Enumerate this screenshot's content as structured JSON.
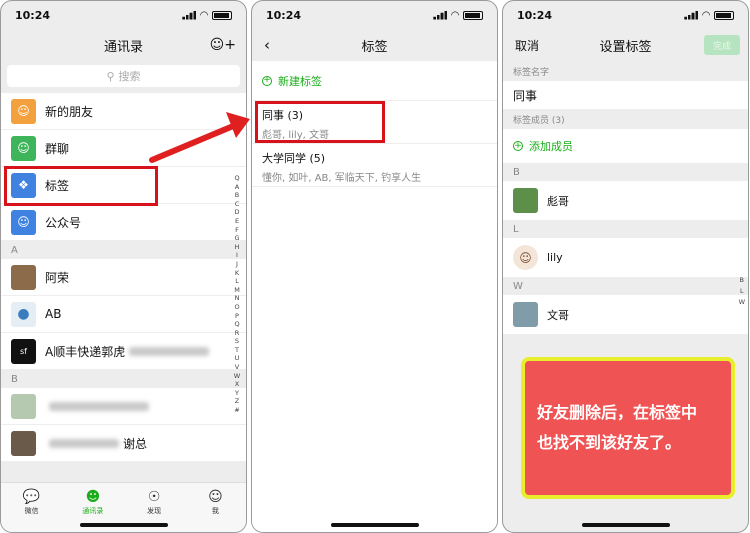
{
  "status": {
    "time": "10:24"
  },
  "contacts": {
    "title": "通讯录",
    "search_placeholder": "搜索",
    "entries": [
      {
        "label": "新的朋友",
        "color": "#f3a13f",
        "icon": "person-add-icon"
      },
      {
        "label": "群聊",
        "color": "#3eb55b",
        "icon": "group-icon"
      },
      {
        "label": "标签",
        "color": "#3f82e0",
        "icon": "tag-icon"
      },
      {
        "label": "公众号",
        "color": "#3f82e0",
        "icon": "person-icon"
      }
    ],
    "section_a": "A",
    "section_b": "B",
    "people_a": [
      {
        "name": "阿荣"
      },
      {
        "name": "AB"
      },
      {
        "name": "A顺丰快递郭虎"
      }
    ],
    "people_b": [
      {
        "name": ""
      },
      {
        "name": "谢总"
      }
    ],
    "alphabet": [
      "Q",
      "A",
      "B",
      "C",
      "D",
      "E",
      "F",
      "G",
      "H",
      "I",
      "J",
      "K",
      "L",
      "M",
      "N",
      "O",
      "P",
      "Q",
      "R",
      "S",
      "T",
      "U",
      "V",
      "W",
      "X",
      "Y",
      "Z",
      "#"
    ]
  },
  "tabbar": {
    "items": [
      {
        "label": "微信",
        "icon": "chat-bubble-icon"
      },
      {
        "label": "通讯录",
        "icon": "contacts-icon"
      },
      {
        "label": "发现",
        "icon": "compass-icon"
      },
      {
        "label": "我",
        "icon": "me-icon"
      }
    ]
  },
  "tags": {
    "title": "标签",
    "new_tag": "新建标签",
    "items": [
      {
        "name": "同事 (3)",
        "members": "彪哥, lily, 文哥"
      },
      {
        "name": "大学同学 (5)",
        "members": "懂你, 如叶, AB, 军临天下, 钓享人生"
      }
    ]
  },
  "settag": {
    "cancel": "取消",
    "title": "设置标签",
    "done": "完成",
    "name_label": "标签名字",
    "name_value": "同事",
    "members_label": "标签成员 (3)",
    "add_member": "添加成员",
    "groups": [
      {
        "letter": "B",
        "name": "彪哥"
      },
      {
        "letter": "L",
        "name": "lily"
      },
      {
        "letter": "W",
        "name": "文哥"
      }
    ],
    "side_letters": [
      "B",
      "L",
      "W"
    ]
  },
  "callout": {
    "line1": "好友删除后，在标签中",
    "line2": "也找不到该好友了。"
  },
  "colors": {
    "wechat_green": "#1aad19",
    "highlight_red": "#d8121b",
    "callout_bg": "#f05353",
    "callout_border": "#e8ee2c"
  }
}
